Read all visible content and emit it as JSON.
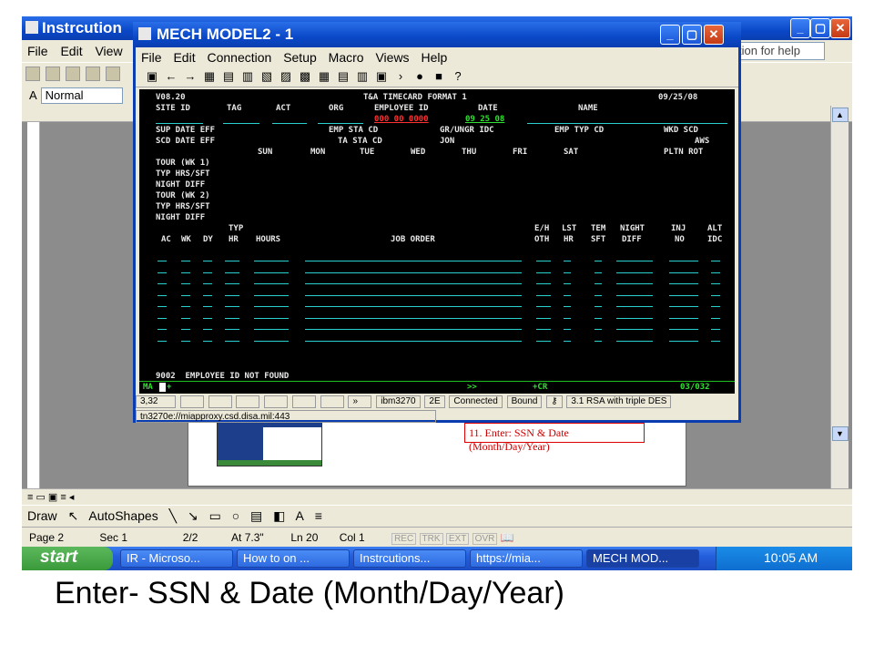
{
  "word": {
    "title": "Instrcution",
    "menu": [
      "File",
      "Edit",
      "View"
    ],
    "help_placeholder": "tion for help",
    "style_value": "Normal",
    "redbox_text": "11. Enter: SSN & Date (Month/Day/Year)",
    "draw_label": "Draw",
    "autoshapes_label": "AutoShapes",
    "status": {
      "page": "Page 2",
      "sec": "Sec 1",
      "pages": "2/2",
      "at": "At 7.3\"",
      "ln": "Ln 20",
      "col": "Col 1",
      "rec": "REC",
      "trk": "TRK",
      "ext": "EXT",
      "ovr": "OVR"
    }
  },
  "terminal_window": {
    "title": "MECH MODEL2 - 1",
    "menu": [
      "File",
      "Edit",
      "Connection",
      "Setup",
      "Macro",
      "Views",
      "Help"
    ],
    "toolbar_glyphs": [
      "▣",
      "←",
      "→",
      "▦",
      "▤",
      "▥",
      "▧",
      "▨",
      "▩",
      "▦",
      "▤",
      "▥",
      "▣",
      "›",
      "●",
      "■",
      "?"
    ]
  },
  "screen": {
    "version": "V08.20",
    "form_title": "T&A TIMECARD FORMAT 1",
    "date": "09/25/08",
    "hdr_site": "SITE ID",
    "hdr_tag": "TAG",
    "hdr_act": "ACT",
    "hdr_org": "ORG",
    "hdr_empid": "EMPLOYEE ID",
    "hdr_date": "DATE",
    "hdr_name": "NAME",
    "emp_id_value": "000 00 0000",
    "date_value": "09 25 08",
    "sup_date": "SUP DATE EFF",
    "emp_sta": "EMP STA CD",
    "gr_ungr": "GR/UNGR IDC",
    "emp_typ": "EMP TYP CD",
    "wkd_scd": "WKD SCD",
    "scd_date": "SCD DATE EFF",
    "ta_sta": "TA STA CD",
    "jon": "JON",
    "aws": "AWS",
    "days": [
      "SUN",
      "MON",
      "TUE",
      "WED",
      "THU",
      "FRI",
      "SAT"
    ],
    "pltn_rot": "PLTN ROT",
    "left_labels": [
      "TOUR (WK 1)",
      "TYP HRS/SFT",
      "NIGHT DIFF",
      "TOUR (WK 2)",
      "TYP HRS/SFT",
      "NIGHT DIFF"
    ],
    "grid_hdr1": {
      "typ": "TYP",
      "eh": "E/H",
      "lst": "LST",
      "tem": "TEM",
      "night": "NIGHT",
      "inj": "INJ",
      "alt": "ALT"
    },
    "grid_hdr2": {
      "ac": "AC",
      "wk": "WK",
      "dy": "DY",
      "hr": "HR",
      "hours": "HOURS",
      "job": "JOB ORDER",
      "oth": "OTH",
      "lhr": "HR",
      "sft": "SFT",
      "diff": "DIFF",
      "no": "NO",
      "idc": "IDC"
    },
    "message": "9002  EMPLOYEE ID NOT FOUND",
    "oia_left": "MA",
    "oia_plus": "+",
    "oia_arrows": ">>",
    "oia_cr": "+CR",
    "oia_pos": "03/032"
  },
  "terminal_status": {
    "cursor": "3,32",
    "arrows": "»",
    "model": "ibm3270",
    "mode": "2E",
    "conn": "Connected",
    "bound": "Bound",
    "cipher": "3.1 RSA with triple DES",
    "url": "tn3270e://miapproxy.csd.disa.mil:443"
  },
  "taskbar": {
    "start": "start",
    "tasks": [
      "IR - Microso...",
      "How to on ...",
      "Instrcutions...",
      "https://mia...",
      "MECH MOD..."
    ],
    "time": "10:05 AM"
  },
  "caption": "Enter- SSN & Date (Month/Day/Year)"
}
